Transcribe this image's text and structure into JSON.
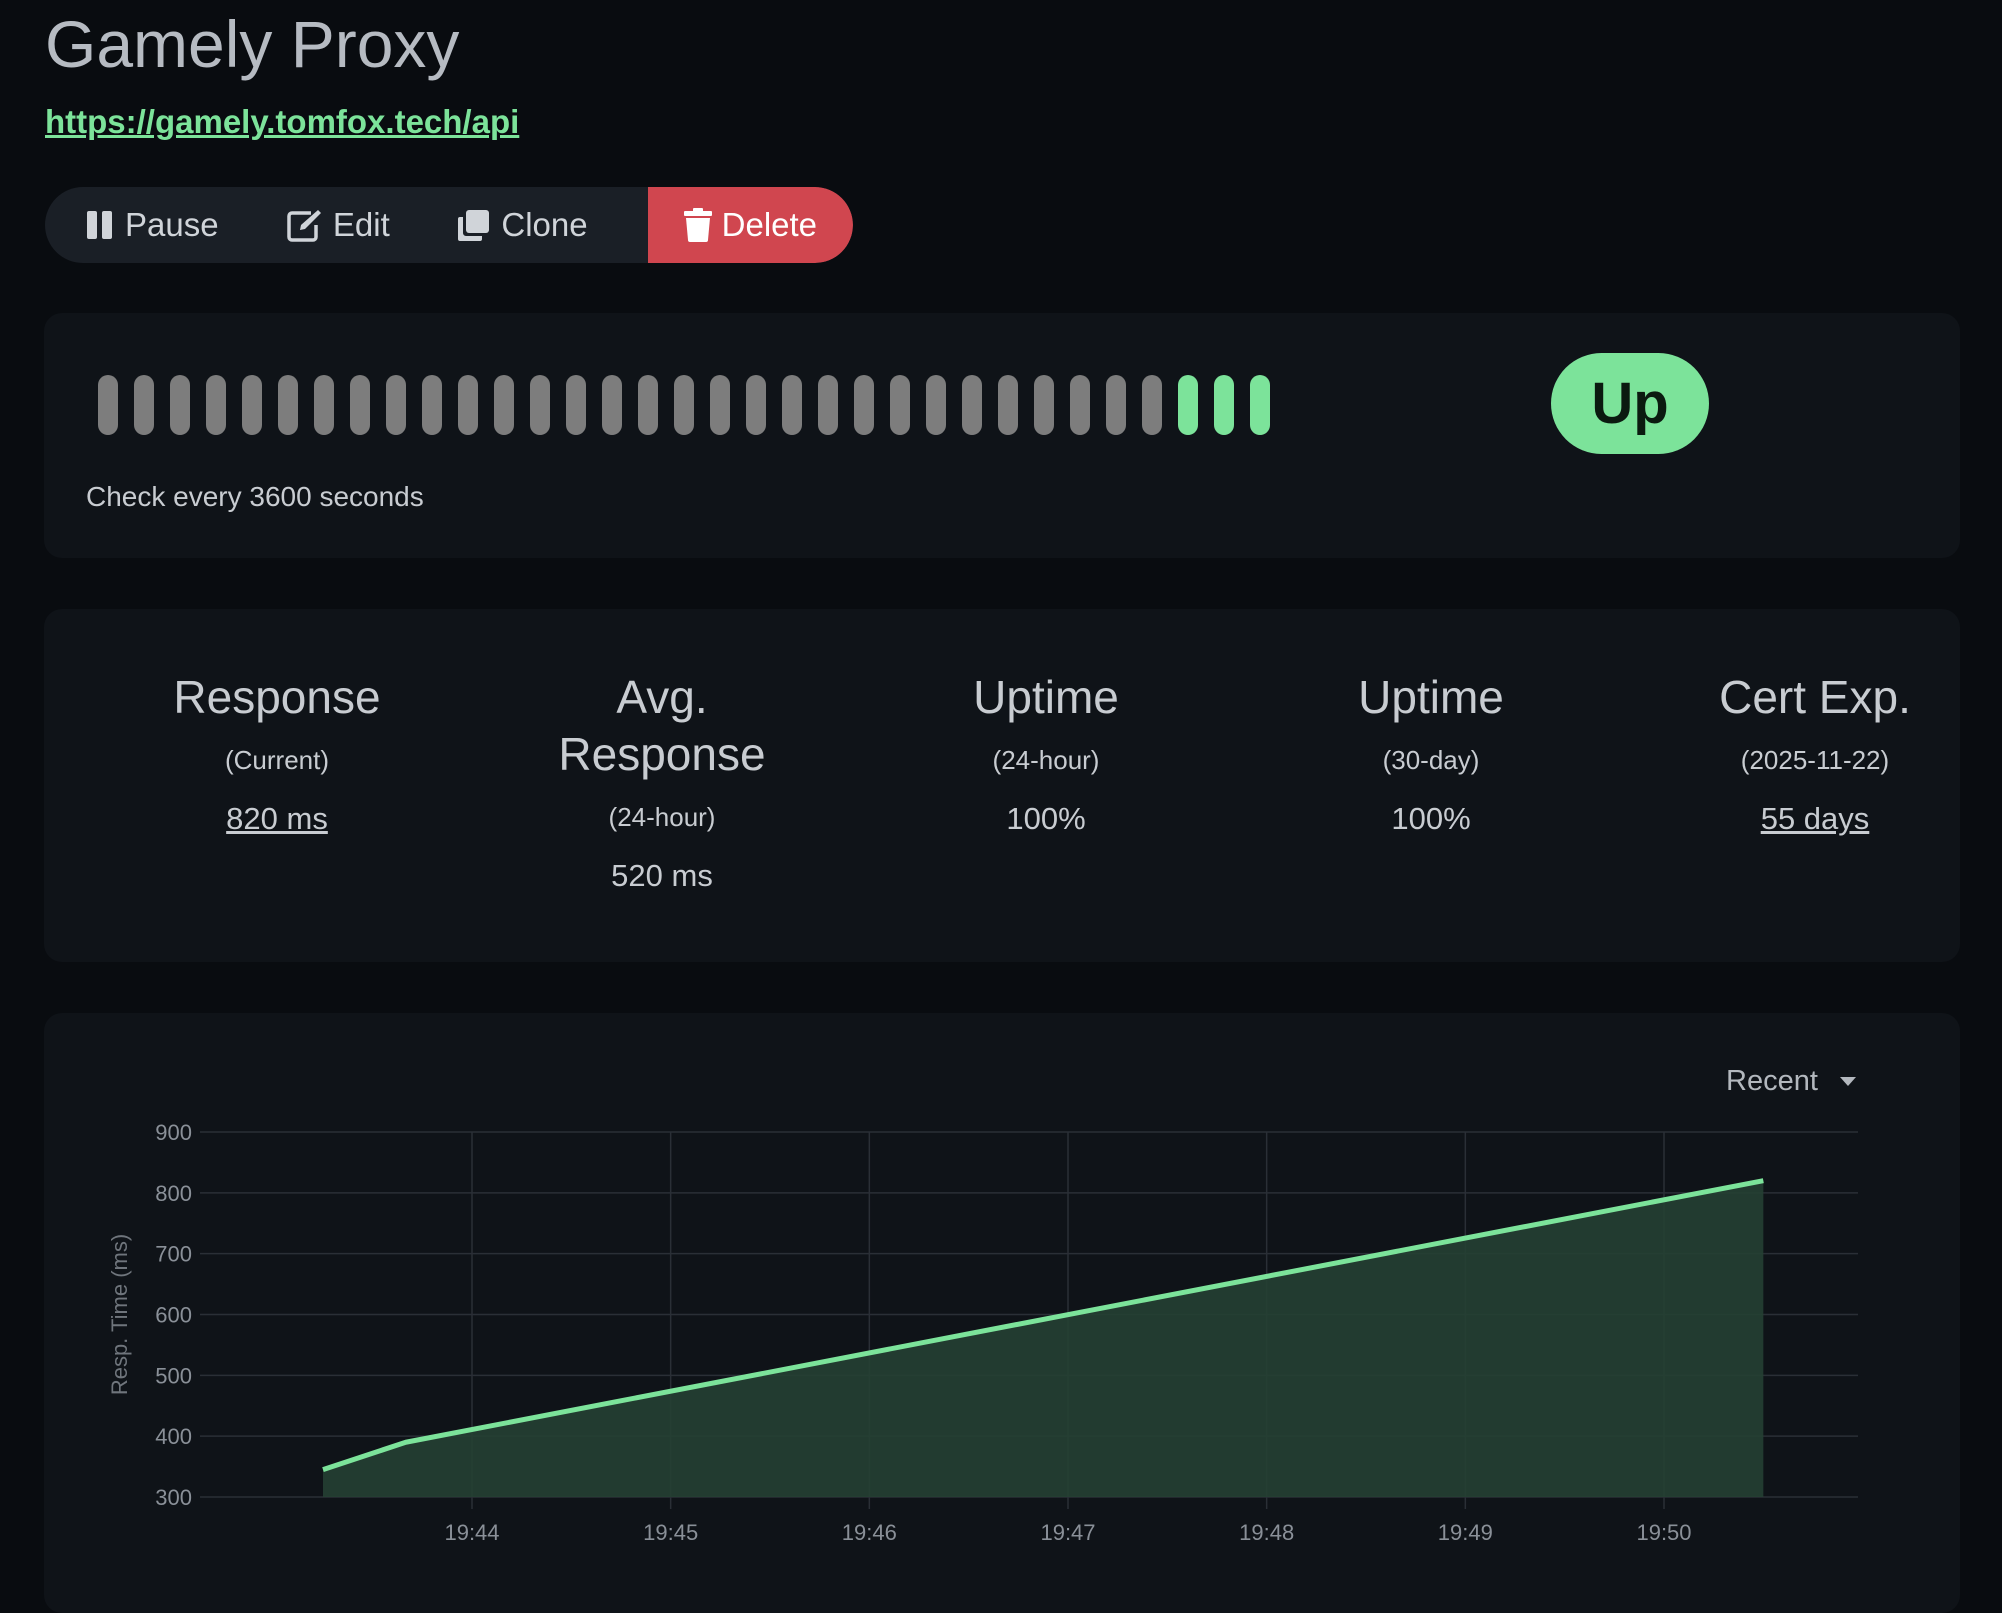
{
  "monitor": {
    "name": "Gamely Proxy",
    "url": "https://gamely.tomfox.tech/api"
  },
  "actions": {
    "pause": "Pause",
    "edit": "Edit",
    "clone": "Clone",
    "delete": "Delete"
  },
  "heartbeat": {
    "beats": [
      "empty",
      "empty",
      "empty",
      "empty",
      "empty",
      "empty",
      "empty",
      "empty",
      "empty",
      "empty",
      "empty",
      "empty",
      "empty",
      "empty",
      "empty",
      "empty",
      "empty",
      "empty",
      "empty",
      "empty",
      "empty",
      "empty",
      "empty",
      "empty",
      "empty",
      "empty",
      "empty",
      "empty",
      "empty",
      "empty",
      "up",
      "up",
      "up"
    ],
    "status": "Up",
    "interval_text": "Check every 3600 seconds",
    "colors": {
      "up": "#7ce39a",
      "empty": "#7d7d7d"
    }
  },
  "stats": [
    {
      "title": "Response",
      "subtitle": "(Current)",
      "value": "820 ms",
      "link": true
    },
    {
      "title": "Avg. Response",
      "subtitle": "(24-hour)",
      "value": "520 ms",
      "link": false
    },
    {
      "title": "Uptime",
      "subtitle": "(24-hour)",
      "value": "100%",
      "link": false
    },
    {
      "title": "Uptime",
      "subtitle": "(30-day)",
      "value": "100%",
      "link": false
    },
    {
      "title": "Cert Exp.",
      "subtitle": "(2025-11-22)",
      "value": "55 days",
      "link": true
    }
  ],
  "chart_controls": {
    "range": "Recent"
  },
  "chart_data": {
    "type": "area",
    "ylabel": "Resp. Time (ms)",
    "xlabel": "",
    "ylim": [
      300,
      900
    ],
    "yticks": [
      300,
      400,
      500,
      600,
      700,
      800,
      900
    ],
    "xticks": [
      "19:44",
      "19:45",
      "19:46",
      "19:47",
      "19:48",
      "19:49",
      "19:50"
    ],
    "grid": true,
    "series": [
      {
        "points": [
          {
            "x": "19:43:15",
            "y": 345
          },
          {
            "x": "19:43:40",
            "y": 390
          },
          {
            "x": "19:50:30",
            "y": 820
          }
        ],
        "color": "#7ce39a",
        "fill": "#254033"
      }
    ]
  }
}
